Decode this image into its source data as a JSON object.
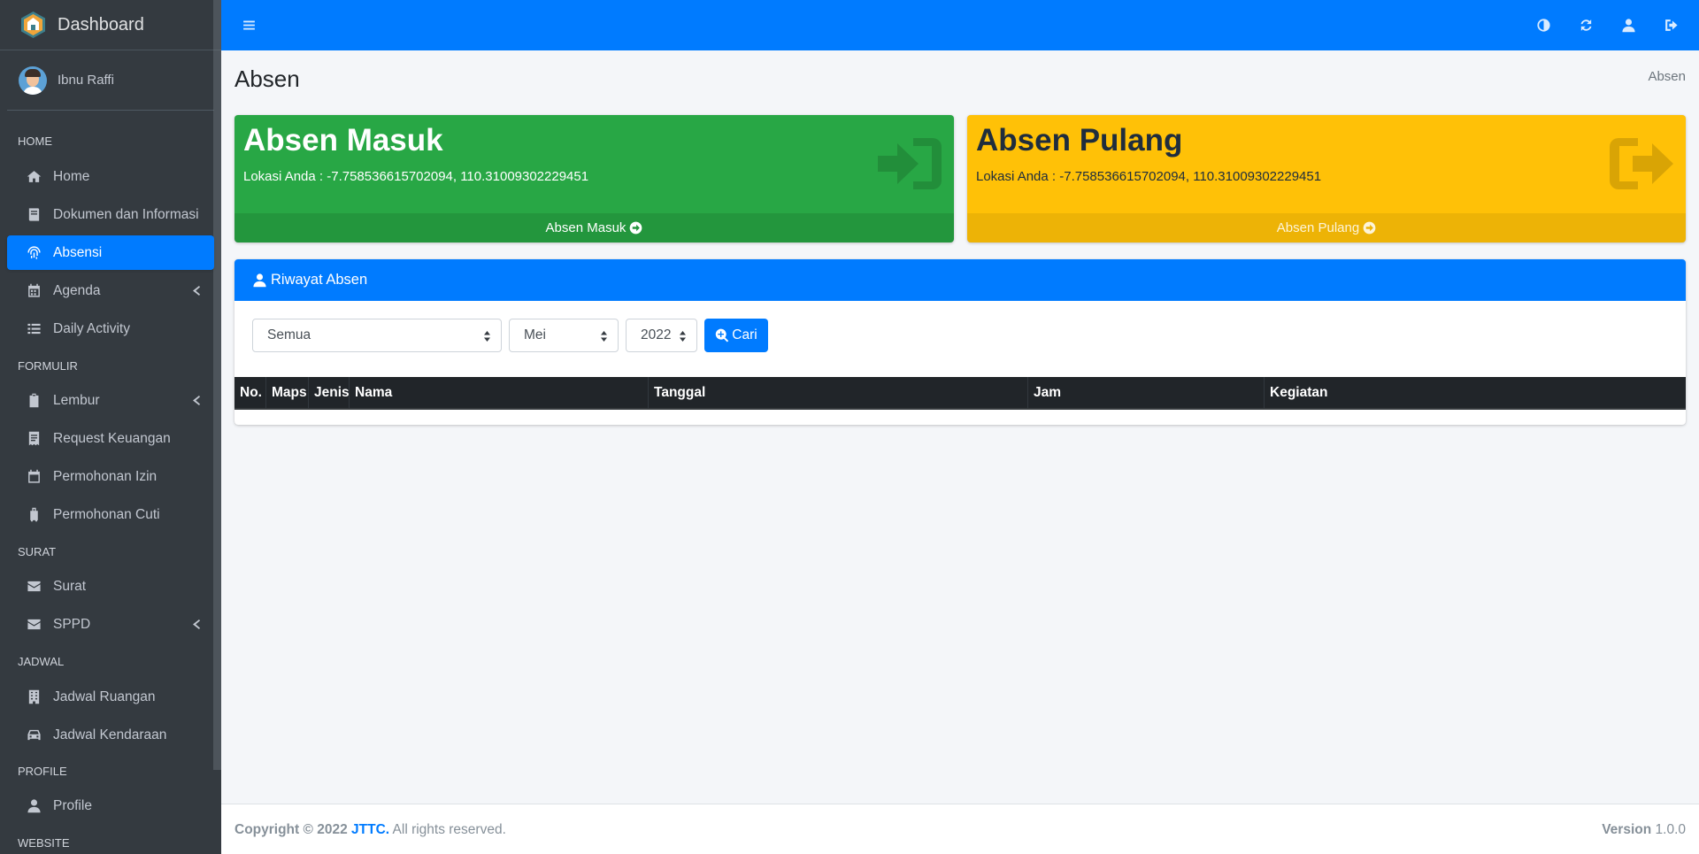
{
  "brand": {
    "title": "Dashboard",
    "logo_icon": "house-shield-logo"
  },
  "user": {
    "name": "Ibnu Raffi"
  },
  "sidebar": {
    "sections": [
      {
        "header": "HOME"
      },
      {
        "header": "FORMULIR"
      },
      {
        "header": "SURAT"
      },
      {
        "header": "JADWAL"
      },
      {
        "header": "PROFILE"
      },
      {
        "header": "WEBSITE"
      }
    ],
    "items": [
      {
        "label": "Home",
        "icon": "home-icon",
        "active": false,
        "has_submenu": false
      },
      {
        "label": "Dokumen dan Informasi",
        "icon": "book-icon",
        "active": false,
        "has_submenu": false
      },
      {
        "label": "Absensi",
        "icon": "fingerprint-icon",
        "active": true,
        "has_submenu": false
      },
      {
        "label": "Agenda",
        "icon": "calendar-icon",
        "active": false,
        "has_submenu": true
      },
      {
        "label": "Daily Activity",
        "icon": "list-icon",
        "active": false,
        "has_submenu": false
      },
      {
        "label": "Lembur",
        "icon": "clipboard-icon",
        "active": false,
        "has_submenu": true
      },
      {
        "label": "Request Keuangan",
        "icon": "receipt-icon",
        "active": false,
        "has_submenu": false
      },
      {
        "label": "Permohonan Izin",
        "icon": "calendar-icon",
        "active": false,
        "has_submenu": false
      },
      {
        "label": "Permohonan Cuti",
        "icon": "suitcase-icon",
        "active": false,
        "has_submenu": false
      },
      {
        "label": "Surat",
        "icon": "envelope-icon",
        "active": false,
        "has_submenu": false
      },
      {
        "label": "SPPD",
        "icon": "envelope-icon",
        "active": false,
        "has_submenu": true
      },
      {
        "label": "Jadwal Ruangan",
        "icon": "building-icon",
        "active": false,
        "has_submenu": false
      },
      {
        "label": "Jadwal Kendaraan",
        "icon": "car-icon",
        "active": false,
        "has_submenu": false
      },
      {
        "label": "Profile",
        "icon": "user-icon",
        "active": false,
        "has_submenu": false
      }
    ]
  },
  "topbar": {
    "icons": [
      "bars-icon",
      "contrast-icon",
      "refresh-icon",
      "user-icon",
      "sign-out-icon"
    ]
  },
  "page": {
    "title": "Absen",
    "breadcrumb": "Absen"
  },
  "absen_masuk": {
    "title": "Absen Masuk",
    "location": "Lokasi Anda : -7.758536615702094, 110.31009302229451",
    "footer_label": "Absen Masuk",
    "color": "#28a745"
  },
  "absen_pulang": {
    "title": "Absen Pulang",
    "location": "Lokasi Anda : -7.758536615702094, 110.31009302229451",
    "footer_label": "Absen Pulang",
    "color": "#ffc107"
  },
  "riwayat": {
    "title": "Riwayat Absen",
    "filter_type": "Semua",
    "filter_month": "Mei",
    "filter_year": "2022",
    "search_label": "Cari",
    "columns": [
      "No.",
      "Maps",
      "Jenis",
      "Nama",
      "Tanggal",
      "Jam",
      "Kegiatan"
    ],
    "rows": []
  },
  "footer": {
    "copyright_prefix": "Copyright © 2022",
    "company": "JTTC.",
    "rights": "All rights reserved.",
    "version_label": "Version",
    "version": "1.0.0"
  },
  "colors": {
    "primary": "#007bff",
    "sidebar": "#343a40",
    "success": "#28a745",
    "warning": "#ffc107"
  }
}
